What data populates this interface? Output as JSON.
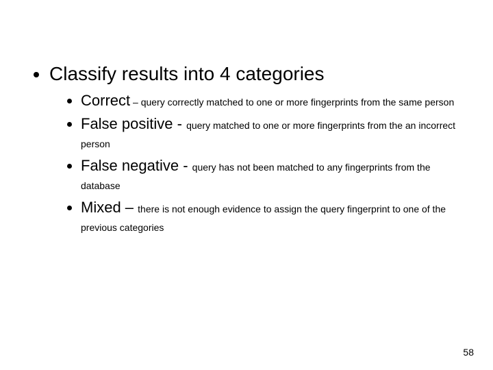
{
  "main": {
    "heading": "Classify results into 4 categories",
    "items": [
      {
        "term": "Correct",
        "sep": " – ",
        "sepClass": "sep-small",
        "desc": "query correctly matched to one or more fingerprints from the same person"
      },
      {
        "term": "False positive",
        "sep": " - ",
        "sepClass": "sep",
        "desc": "query matched to one or more fingerprints from the an incorrect person"
      },
      {
        "term": "False negative",
        "sep": " - ",
        "sepClass": "sep",
        "desc": "query has not been matched to any fingerprints from the database"
      },
      {
        "term": "Mixed",
        "sep": " – ",
        "sepClass": "sep",
        "desc": "there is not enough evidence to assign the query fingerprint to one of the previous categories"
      }
    ]
  },
  "page_number": "58"
}
